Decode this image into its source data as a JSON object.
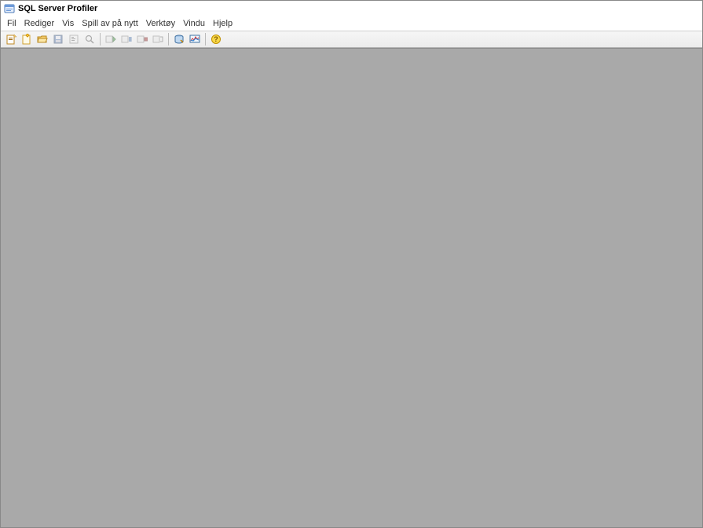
{
  "window": {
    "title": "SQL Server Profiler"
  },
  "menu": {
    "items": [
      "Fil",
      "Rediger",
      "Vis",
      "Spill av på nytt",
      "Verktøy",
      "Vindu",
      "Hjelp"
    ]
  },
  "toolbar": {
    "icons": [
      "new-trace-icon",
      "new-template-icon",
      "open-folder-icon",
      "save-icon",
      "properties-icon",
      "find-icon",
      "run-trace-icon",
      "pause-trace-icon",
      "stop-trace-icon",
      "templates-icon",
      "database-tuning-icon",
      "perf-monitor-icon",
      "help-icon"
    ]
  }
}
